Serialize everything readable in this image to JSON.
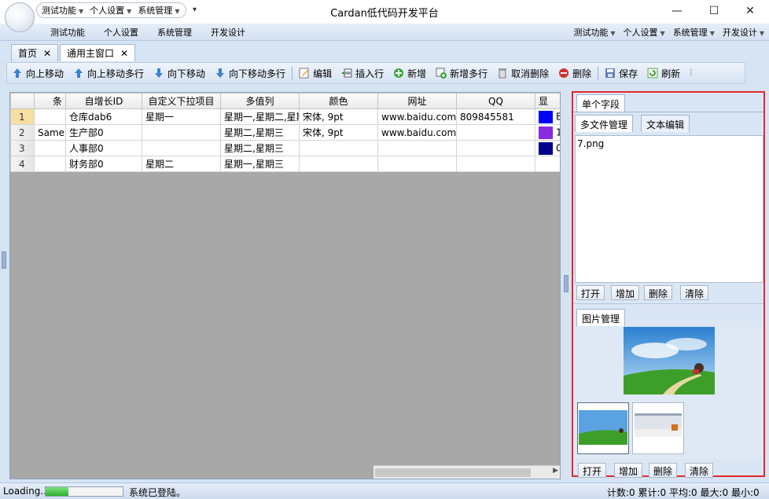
{
  "window": {
    "title": "Cardan低代码开发平台",
    "controls": [
      "—",
      "☐",
      "✕"
    ]
  },
  "quick_access": {
    "items": [
      "测试功能",
      "个人设置",
      "系统管理"
    ],
    "more": "▾"
  },
  "menubar": {
    "left": [
      "测试功能",
      "个人设置",
      "系统管理",
      "开发设计"
    ],
    "right": [
      "测试功能",
      "个人设置",
      "系统管理",
      "开发设计"
    ]
  },
  "doc_tabs": [
    {
      "label": "首页",
      "close": "✕"
    },
    {
      "label": "通用主窗口",
      "close": "✕"
    }
  ],
  "toolbar": {
    "items": [
      {
        "label": "向上移动",
        "icon": "arrow-up-icon"
      },
      {
        "label": "向上移动多行",
        "icon": "arrow-up-multi-icon"
      },
      {
        "label": "向下移动",
        "icon": "arrow-down-icon"
      },
      {
        "label": "向下移动多行",
        "icon": "arrow-down-multi-icon"
      },
      {
        "label": "编辑",
        "icon": "edit-icon"
      },
      {
        "label": "插入行",
        "icon": "insert-row-icon"
      },
      {
        "label": "新增",
        "icon": "add-icon"
      },
      {
        "label": "新增多行",
        "icon": "add-multi-icon"
      },
      {
        "label": "取消删除",
        "icon": "undo-delete-icon"
      },
      {
        "label": "删除",
        "icon": "delete-icon"
      },
      {
        "label": "保存",
        "icon": "save-icon"
      },
      {
        "label": "刷新",
        "icon": "refresh-icon"
      }
    ],
    "overflow": "⫶"
  },
  "grid": {
    "columns": [
      "条",
      "自增长ID",
      "自定义下拉项目",
      "多值列",
      "颜色",
      "网址",
      "QQ",
      "显"
    ],
    "rows": [
      {
        "num": "1",
        "cells": [
          "",
          "仓库dab6",
          "星期一",
          "星期一,星期二,星期",
          "宋体, 9pt",
          "www.baidu.com",
          "809845581",
          "E"
        ],
        "color": "#0000ff"
      },
      {
        "num": "2",
        "cells": [
          "Same",
          "生产部0",
          "",
          "星期二,星期三",
          "宋体, 9pt",
          "www.baidu.com",
          "",
          "1"
        ],
        "color": "#8a2be2"
      },
      {
        "num": "3",
        "cells": [
          "",
          "人事部0",
          "",
          "星期二,星期三",
          "",
          "",
          "",
          "0"
        ],
        "color": "#00008b"
      },
      {
        "num": "4",
        "cells": [
          "",
          "财务部0",
          "星期二",
          "星期一,星期三",
          "",
          "",
          "",
          ""
        ],
        "color": ""
      }
    ]
  },
  "right_panel": {
    "single_field_tab": "单个字段",
    "tabs": [
      "多文件管理",
      "文本编辑"
    ],
    "files": [
      "7.png"
    ],
    "file_buttons": [
      "打开",
      "增加",
      "删除",
      "清除"
    ],
    "image_tab": "图片管理",
    "image_buttons": [
      "打开",
      "增加",
      "删除",
      "清除"
    ]
  },
  "status": {
    "loading": "Loading...",
    "progress_fraction": 0.3,
    "message": "系统已登陆。",
    "stats": "计数:0 累计:0 平均:0 最大:0 最小:0"
  }
}
